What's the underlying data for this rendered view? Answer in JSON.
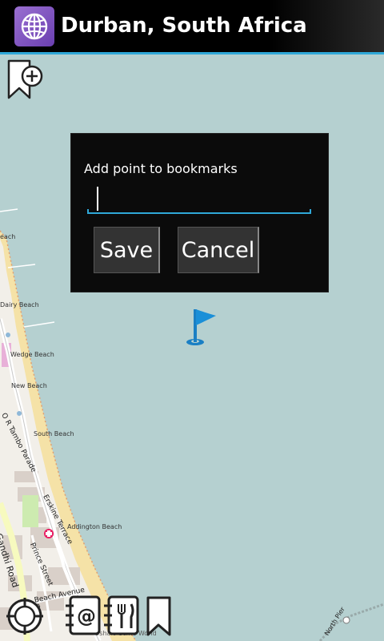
{
  "header": {
    "title": "Durban, South Africa",
    "app_icon": "globe-icon"
  },
  "map": {
    "labels": [
      "each",
      "Dairy Beach",
      "Wedge Beach",
      "New Beach",
      "South Beach",
      "Addington Beach"
    ],
    "roads": [
      "O R Tambo Parade",
      "Erskine Terrace",
      "Prince Street",
      "Gandhi Road",
      "Beach Avenue",
      "South",
      "North Pier",
      "Oshalo Scme World"
    ],
    "colors": {
      "sea": "#b5d0d0",
      "land": "#f2efe9",
      "beach": "#f5e2a7",
      "road": "#ffffff",
      "building": "#d9d0c9"
    }
  },
  "dialog": {
    "label": "Add point to bookmarks",
    "input_value": "",
    "save_label": "Save",
    "cancel_label": "Cancel"
  },
  "toolbar": {
    "icons": [
      "compass-icon",
      "contacts-icon",
      "restaurant-icon",
      "bookmark-icon"
    ]
  },
  "accent_color": "#2fa8d8"
}
